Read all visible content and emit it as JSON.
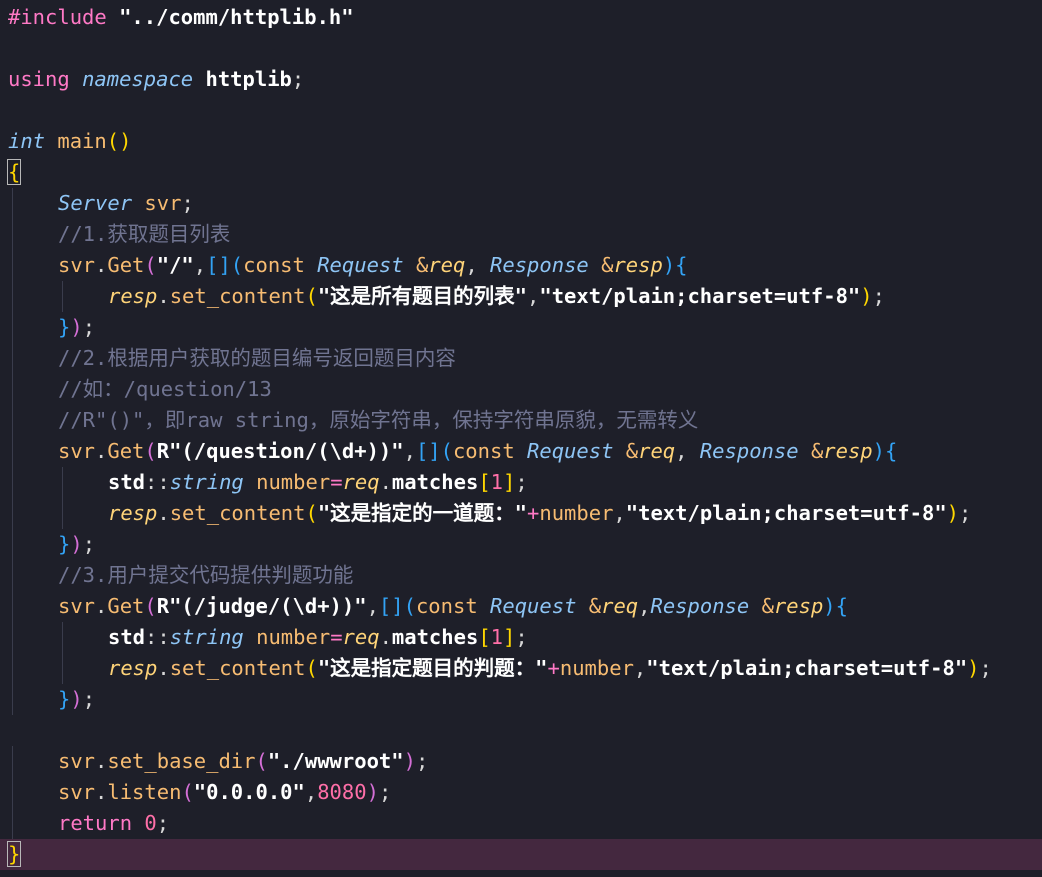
{
  "lines": [
    [
      [
        "kw",
        "#include "
      ],
      [
        "str",
        "\"../comm/httplib.h\""
      ]
    ],
    [],
    [
      [
        "kw",
        "using "
      ],
      [
        "typ",
        "namespace "
      ],
      [
        "str",
        "httplib"
      ],
      [
        "pun",
        ";"
      ]
    ],
    [],
    [
      [
        "typ",
        "int "
      ],
      [
        "fn",
        "main"
      ],
      [
        "br1",
        "()"
      ]
    ],
    [
      [
        "br1",
        "{"
      ]
    ],
    [
      [
        "typ",
        "Server "
      ],
      [
        "fn",
        "svr"
      ],
      [
        "pun",
        ";"
      ]
    ],
    [
      [
        "cmt",
        "//1.获取题目列表"
      ]
    ],
    [
      [
        "fn",
        "svr"
      ],
      [
        "pun",
        "."
      ],
      [
        "fn",
        "Get"
      ],
      [
        "br2",
        "("
      ],
      [
        "str",
        "\"/\""
      ],
      [
        "pun",
        ","
      ],
      [
        "br3",
        "[]("
      ],
      [
        "fn",
        "const "
      ],
      [
        "typ",
        "Request "
      ],
      [
        "fn",
        "&"
      ],
      [
        "par",
        "req"
      ],
      [
        "pun",
        ", "
      ],
      [
        "typ",
        "Response "
      ],
      [
        "fn",
        "&"
      ],
      [
        "par",
        "resp"
      ],
      [
        "br3",
        "){"
      ]
    ],
    [
      [
        "par",
        "resp"
      ],
      [
        "pun",
        "."
      ],
      [
        "fn",
        "set_content"
      ],
      [
        "br1",
        "("
      ],
      [
        "str",
        "\"这是所有题目的列表\""
      ],
      [
        "pun",
        ","
      ],
      [
        "str",
        "\"text/plain;charset=utf-8\""
      ],
      [
        "br1",
        ")"
      ],
      [
        "pun",
        ";"
      ]
    ],
    [
      [
        "br3",
        "}"
      ],
      [
        "br2",
        ")"
      ],
      [
        "pun",
        ";"
      ]
    ],
    [
      [
        "cmt",
        "//2.根据用户获取的题目编号返回题目内容"
      ]
    ],
    [
      [
        "cmt",
        "//如：/question/13"
      ]
    ],
    [
      [
        "cmt",
        "//R\"()\"，即raw string，原始字符串，保持字符串原貌，无需转义"
      ]
    ],
    [
      [
        "fn",
        "svr"
      ],
      [
        "pun",
        "."
      ],
      [
        "fn",
        "Get"
      ],
      [
        "br2",
        "("
      ],
      [
        "str",
        "R\"(/question/(\\d+))\""
      ],
      [
        "pun",
        ","
      ],
      [
        "br3",
        "[]("
      ],
      [
        "fn",
        "const "
      ],
      [
        "typ",
        "Request "
      ],
      [
        "fn",
        "&"
      ],
      [
        "par",
        "req"
      ],
      [
        "pun",
        ", "
      ],
      [
        "typ",
        "Response "
      ],
      [
        "fn",
        "&"
      ],
      [
        "par",
        "resp"
      ],
      [
        "br3",
        "){"
      ]
    ],
    [
      [
        "str",
        "std"
      ],
      [
        "pun",
        "::"
      ],
      [
        "typ",
        "string "
      ],
      [
        "fn",
        "number"
      ],
      [
        "kw",
        "="
      ],
      [
        "par",
        "req"
      ],
      [
        "pun",
        "."
      ],
      [
        "str",
        "matches"
      ],
      [
        "br1",
        "["
      ],
      [
        "num",
        "1"
      ],
      [
        "br1",
        "]"
      ],
      [
        "pun",
        ";"
      ]
    ],
    [
      [
        "par",
        "resp"
      ],
      [
        "pun",
        "."
      ],
      [
        "fn",
        "set_content"
      ],
      [
        "br1",
        "("
      ],
      [
        "str",
        "\"这是指定的一道题：\""
      ],
      [
        "kw",
        "+"
      ],
      [
        "fn",
        "number"
      ],
      [
        "pun",
        ","
      ],
      [
        "str",
        "\"text/plain;charset=utf-8\""
      ],
      [
        "br1",
        ")"
      ],
      [
        "pun",
        ";"
      ]
    ],
    [
      [
        "br3",
        "}"
      ],
      [
        "br2",
        ")"
      ],
      [
        "pun",
        ";"
      ]
    ],
    [
      [
        "cmt",
        "//3.用户提交代码提供判题功能"
      ]
    ],
    [
      [
        "fn",
        "svr"
      ],
      [
        "pun",
        "."
      ],
      [
        "fn",
        "Get"
      ],
      [
        "br2",
        "("
      ],
      [
        "str",
        "R\"(/judge/(\\d+))\""
      ],
      [
        "pun",
        ","
      ],
      [
        "br3",
        "[]("
      ],
      [
        "fn",
        "const "
      ],
      [
        "typ",
        "Request "
      ],
      [
        "fn",
        "&"
      ],
      [
        "par",
        "req"
      ],
      [
        "pun",
        ","
      ],
      [
        "typ",
        "Response "
      ],
      [
        "fn",
        "&"
      ],
      [
        "par",
        "resp"
      ],
      [
        "br3",
        "){"
      ]
    ],
    [
      [
        "str",
        "std"
      ],
      [
        "pun",
        "::"
      ],
      [
        "typ",
        "string "
      ],
      [
        "fn",
        "number"
      ],
      [
        "kw",
        "="
      ],
      [
        "par",
        "req"
      ],
      [
        "pun",
        "."
      ],
      [
        "str",
        "matches"
      ],
      [
        "br1",
        "["
      ],
      [
        "num",
        "1"
      ],
      [
        "br1",
        "]"
      ],
      [
        "pun",
        ";"
      ]
    ],
    [
      [
        "par",
        "resp"
      ],
      [
        "pun",
        "."
      ],
      [
        "fn",
        "set_content"
      ],
      [
        "br1",
        "("
      ],
      [
        "str",
        "\"这是指定题目的判题：\""
      ],
      [
        "kw",
        "+"
      ],
      [
        "fn",
        "number"
      ],
      [
        "pun",
        ","
      ],
      [
        "str",
        "\"text/plain;charset=utf-8\""
      ],
      [
        "br1",
        ")"
      ],
      [
        "pun",
        ";"
      ]
    ],
    [
      [
        "br3",
        "}"
      ],
      [
        "br2",
        ")"
      ],
      [
        "pun",
        ";"
      ]
    ],
    [],
    [
      [
        "fn",
        "svr"
      ],
      [
        "pun",
        "."
      ],
      [
        "fn",
        "set_base_dir"
      ],
      [
        "br2",
        "("
      ],
      [
        "str",
        "\"./wwwroot\""
      ],
      [
        "br2",
        ")"
      ],
      [
        "pun",
        ";"
      ]
    ],
    [
      [
        "fn",
        "svr"
      ],
      [
        "pun",
        "."
      ],
      [
        "fn",
        "listen"
      ],
      [
        "br2",
        "("
      ],
      [
        "str",
        "\"0.0.0.0\""
      ],
      [
        "pun",
        ","
      ],
      [
        "num",
        "8080"
      ],
      [
        "br2",
        ")"
      ],
      [
        "pun",
        ";"
      ]
    ],
    [
      [
        "kw",
        "return "
      ],
      [
        "num",
        "0"
      ],
      [
        "pun",
        ";"
      ]
    ],
    [
      [
        "br1",
        "}"
      ]
    ]
  ]
}
